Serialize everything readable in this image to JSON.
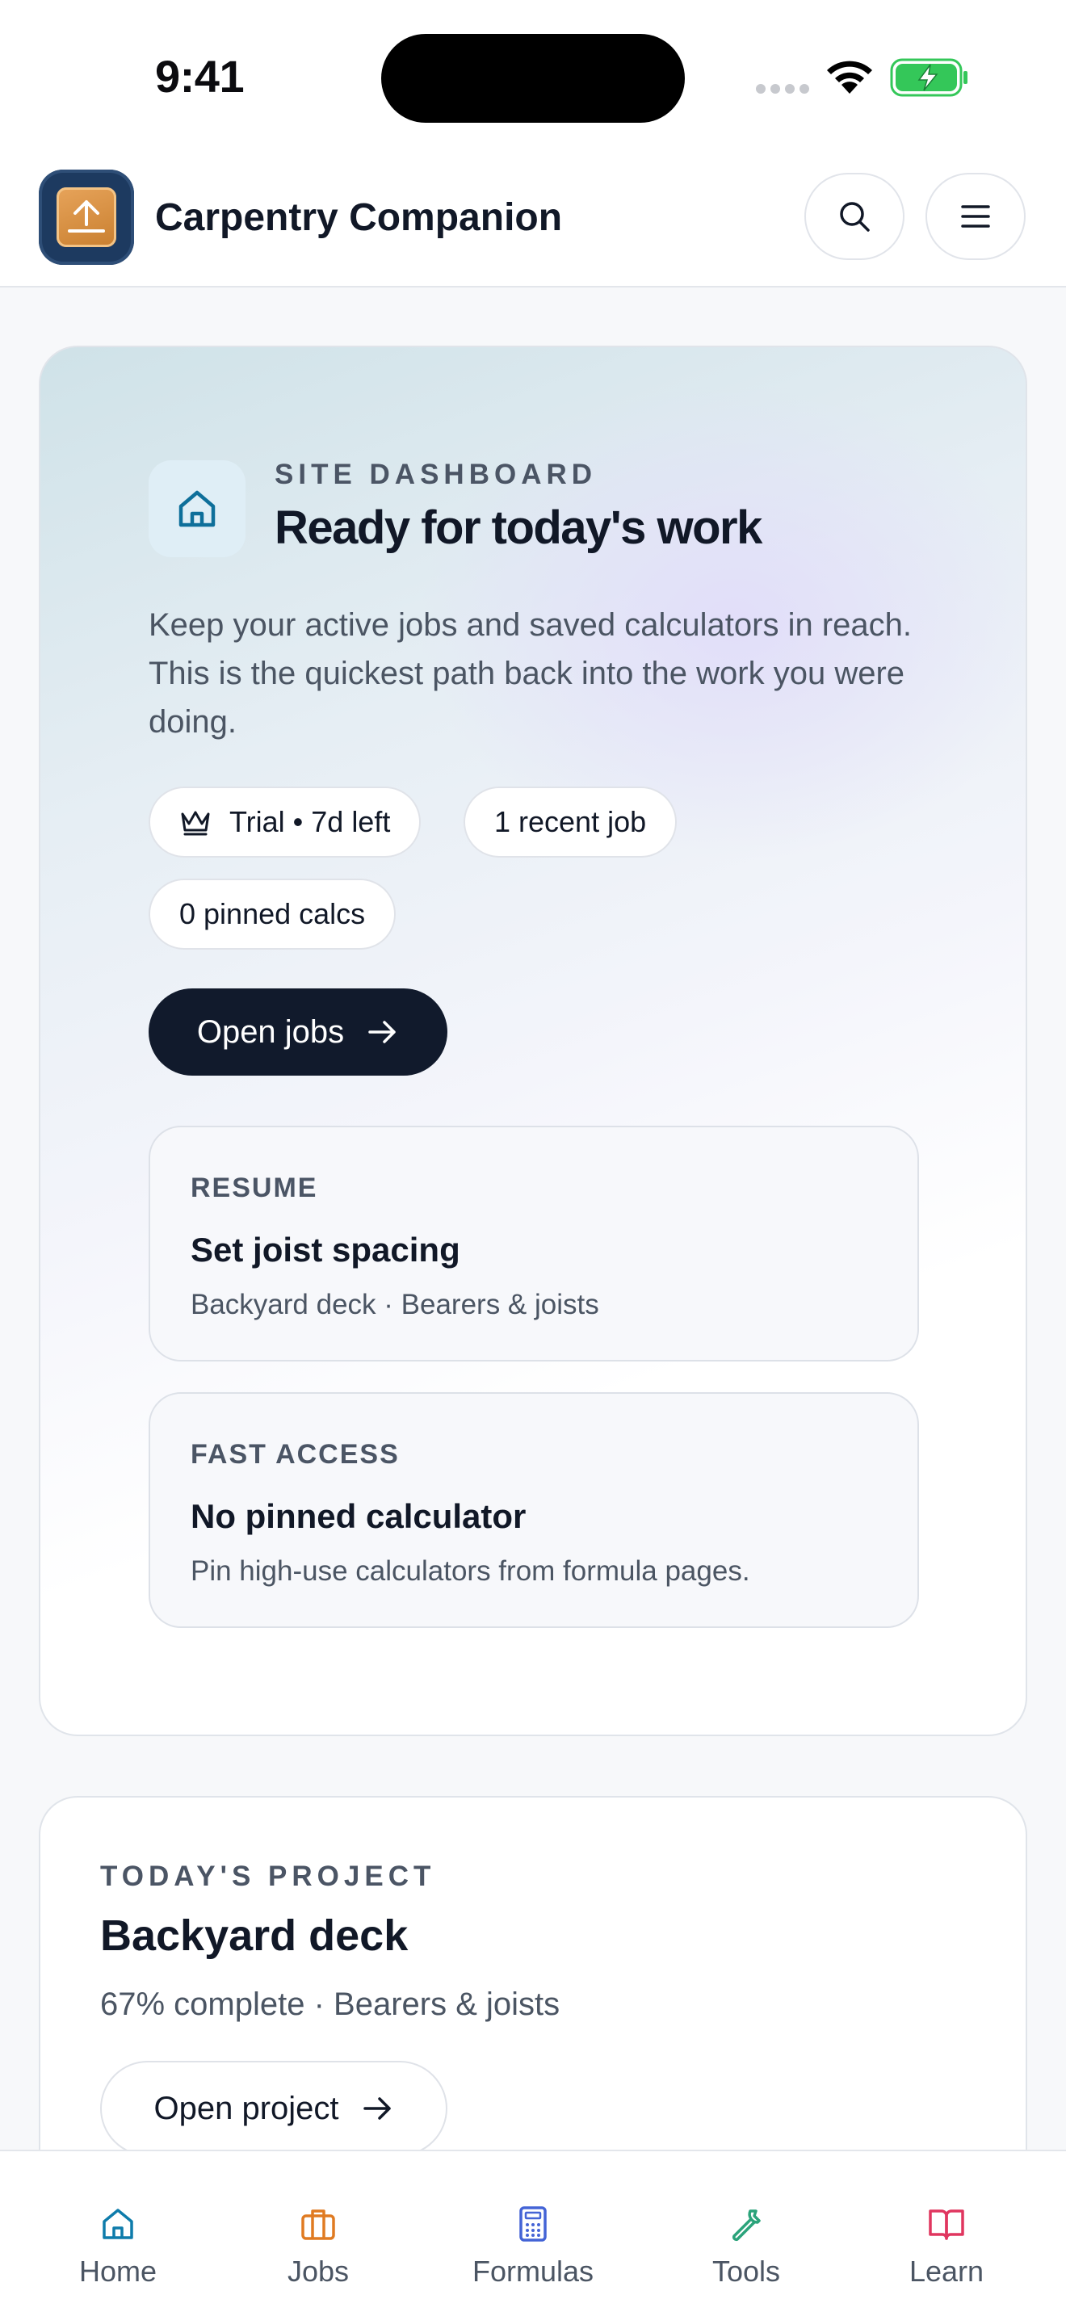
{
  "status_bar": {
    "time": "9:41"
  },
  "app": {
    "title": "Carpentry Companion"
  },
  "header": {
    "search_icon": "search-icon",
    "menu_icon": "menu-icon"
  },
  "hero": {
    "eyebrow": "SITE DASHBOARD",
    "title": "Ready for today's work",
    "description": "Keep your active jobs and saved calculators in reach. This is the quickest path back into the work you were doing.",
    "chips": {
      "trial": "Trial • 7d left",
      "recent": "1 recent job",
      "pinned": "0 pinned calcs"
    },
    "open_jobs": "Open jobs",
    "resume": {
      "label": "RESUME",
      "title": "Set joist spacing",
      "subtitle": "Backyard deck · Bearers & joists"
    },
    "fast_access": {
      "label": "FAST ACCESS",
      "title": "No pinned calculator",
      "subtitle": "Pin high-use calculators from formula pages."
    }
  },
  "project": {
    "eyebrow": "TODAY'S PROJECT",
    "title": "Backyard deck",
    "meta": "67% complete · Bearers & joists",
    "open_project": "Open project"
  },
  "tabs": [
    {
      "label": "Home",
      "icon": "home-icon",
      "color": "#0e7cab"
    },
    {
      "label": "Jobs",
      "icon": "briefcase-icon",
      "color": "#e07b22"
    },
    {
      "label": "Formulas",
      "icon": "calculator-icon",
      "color": "#4464d6"
    },
    {
      "label": "Tools",
      "icon": "wrench-icon",
      "color": "#2aa37a"
    },
    {
      "label": "Learn",
      "icon": "book-icon",
      "color": "#e0365f"
    }
  ],
  "colors": {
    "primary_dark": "#111a2c",
    "accent_teal": "#0e7cab"
  }
}
